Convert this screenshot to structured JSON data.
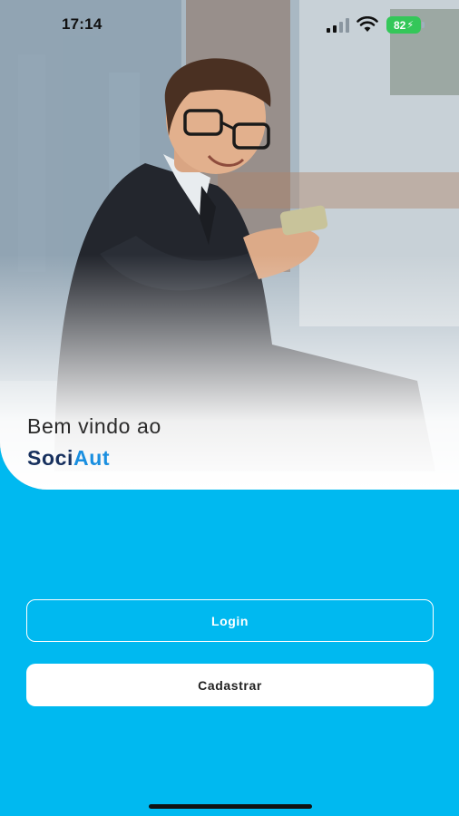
{
  "status_bar": {
    "time": "17:14",
    "battery": "82",
    "battery_color": "#34c759"
  },
  "hero": {
    "image": "man-with-smartphone-photo"
  },
  "welcome": {
    "line": "Bem vindo ao",
    "brand_part1": "Soci",
    "brand_part2": "Aut",
    "brand_color_1": "#17305e",
    "brand_color_2": "#1a8fe0"
  },
  "actions": {
    "login_label": "Login",
    "register_label": "Cadastrar"
  },
  "theme": {
    "background": "#00b9f0"
  }
}
